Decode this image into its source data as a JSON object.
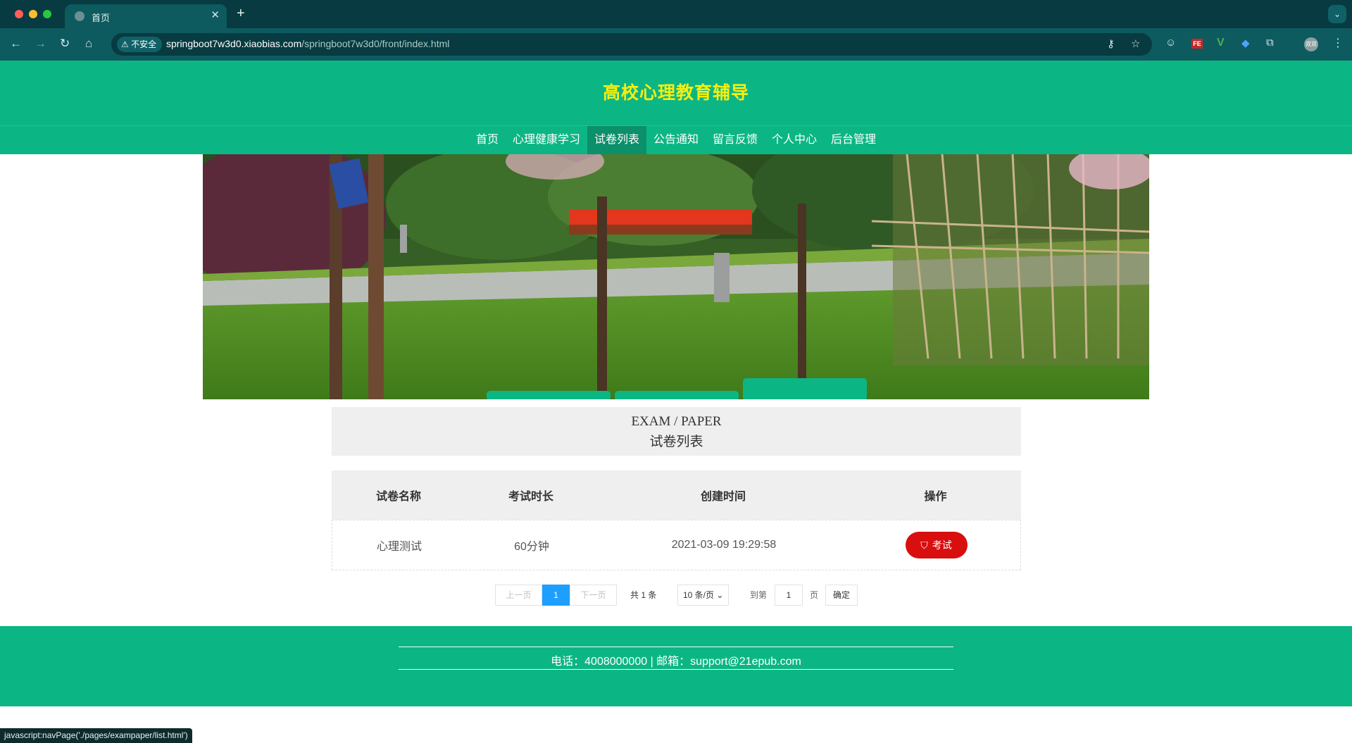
{
  "browser": {
    "tab_title": "首页",
    "insecure_label": "不安全",
    "url_host": "springboot7w3d0.xiaobias.com",
    "url_path": "/springboot7w3d0/front/index.html",
    "profile_label": "双双"
  },
  "site": {
    "title": "高校心理教育辅导",
    "nav": [
      {
        "label": "首页"
      },
      {
        "label": "心理健康学习"
      },
      {
        "label": "试卷列表"
      },
      {
        "label": "公告通知"
      },
      {
        "label": "留言反馈"
      },
      {
        "label": "个人中心"
      },
      {
        "label": "后台管理"
      }
    ],
    "active_nav": "试卷列表"
  },
  "section": {
    "title_en": "EXAM / PAPER",
    "title_cn": "试卷列表"
  },
  "table": {
    "headers": [
      "试卷名称",
      "考试时长",
      "创建时间",
      "操作"
    ],
    "rows": [
      {
        "name": "心理测试",
        "duration": "60分钟",
        "created": "2021-03-09 19:29:58",
        "action": "考试"
      }
    ]
  },
  "pager": {
    "prev": "上一页",
    "current": "1",
    "next": "下一页",
    "total": "共 1 条",
    "page_size": "10 条/页",
    "goto_prefix": "到第",
    "goto_value": "1",
    "goto_suffix": "页",
    "confirm": "确定"
  },
  "footer": {
    "text": "电话：4008000000 | 邮箱：support@21epub.com"
  },
  "statusbar": {
    "text": "javascript:navPage('./pages/exampaper/list.html')"
  },
  "colors": {
    "brand_green": "#0cb684",
    "title_yellow": "#f5ee12",
    "exam_red": "#d90e0e",
    "pager_blue": "#1e9fff"
  }
}
